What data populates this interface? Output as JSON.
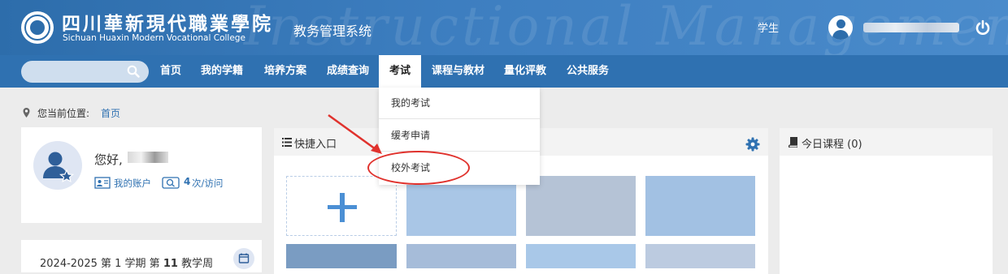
{
  "header": {
    "logo_cn": "四川華新現代職業學院",
    "logo_en": "Sichuan Huaxin Modern Vocational College",
    "system_title": "教务管理系统",
    "watermark": "Instructional Management System",
    "role": "学生",
    "icons": {
      "avatar": "user-avatar-icon",
      "power": "power-icon"
    }
  },
  "nav": {
    "search_placeholder": "",
    "items": [
      {
        "label": "首页"
      },
      {
        "label": "我的学籍"
      },
      {
        "label": "培养方案"
      },
      {
        "label": "成绩查询"
      },
      {
        "label": "考试",
        "active": true
      },
      {
        "label": "课程与教材"
      },
      {
        "label": "量化评教"
      },
      {
        "label": "公共服务"
      }
    ],
    "dropdown": [
      {
        "label": "我的考试"
      },
      {
        "label": "缓考申请"
      },
      {
        "label": "校外考试"
      }
    ]
  },
  "breadcrumb": {
    "label": "您当前位置:",
    "home": "首页"
  },
  "user_card": {
    "greeting": "您好,",
    "account_link": "我的账户",
    "visit_count": "4",
    "visit_unit": "次/访问"
  },
  "term_card": {
    "term": "2024-2025 第 1 学期",
    "week_prefix": "第",
    "week_num": "11",
    "week_suffix": "教学周"
  },
  "quick_entry": {
    "title": "快捷入口",
    "tile_colors": [
      "#a9c6e6",
      "#b5c3d6",
      "#a2c1e3",
      "#7a9cc2",
      "#a6bcd9",
      "#a9c8e8",
      "#bccbe0"
    ]
  },
  "today_courses": {
    "title": "今日课程 (0)"
  },
  "colors": {
    "header_blue": "#2d6dab",
    "nav_blue": "#2f71b1",
    "link_blue": "#2f71b1",
    "annotation_red": "#e0322d"
  }
}
